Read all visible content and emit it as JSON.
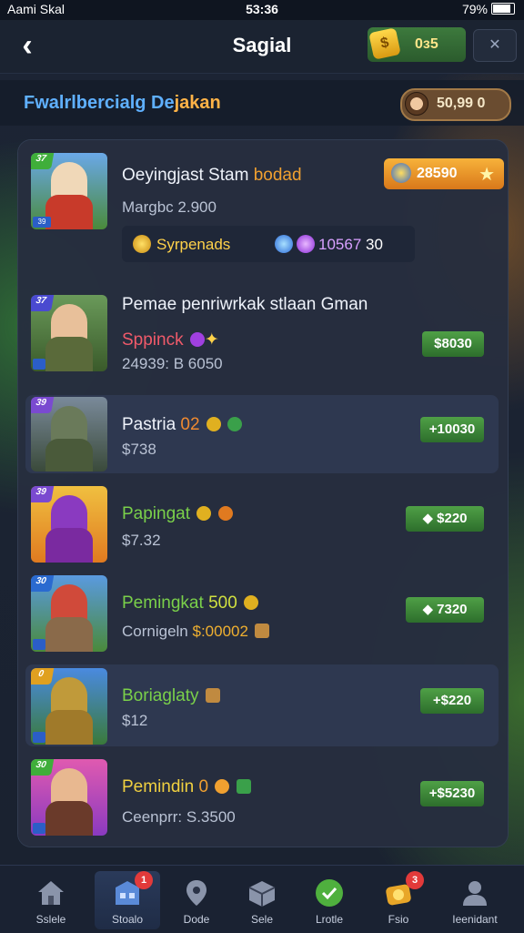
{
  "status": {
    "carrier": "Aami Skal",
    "time": "53:36",
    "battery": "79%"
  },
  "header": {
    "title": "Sagial",
    "currency": "0ɜ5",
    "close_icon": "close-icon"
  },
  "subheader": {
    "title_a": "Fwalrlbercialg De",
    "title_b": "jakan",
    "balance": "50,99 0"
  },
  "featured": {
    "level": "37",
    "thumb_tag": "39",
    "name": "Oeyingjast Stam",
    "name_tag": "bodad",
    "sub": "Margbc 2.900",
    "badge_value": "28590",
    "stat_label": "Syrpenads",
    "stat_value_a": "10567",
    "stat_value_b": "30"
  },
  "items": [
    {
      "level": "37",
      "section": "Pemae penriwrkak stlaan Gman",
      "name": "Sppinck",
      "sub": "24939: B 6050",
      "price": "$8030"
    },
    {
      "level": "39",
      "name": "Pastria",
      "name_tag": "02",
      "sub": "$738",
      "price": "+10030"
    },
    {
      "level": "39",
      "name": "Papingat",
      "sub": "$7.32",
      "price": "$220"
    },
    {
      "level": "30",
      "name": "Pemingkat",
      "name_tag": "500",
      "sub": "Cornigeln",
      "sub_tag": "$:00002",
      "price": "7320"
    },
    {
      "level": "0",
      "name": "Boriaglaty",
      "sub": "$12",
      "price": "+$220"
    },
    {
      "level": "30",
      "name": "Pemindin",
      "name_tag": "0",
      "sub": "Ceenprr: S.3500",
      "price": "+$5230"
    }
  ],
  "nav": [
    {
      "label": "Sslele",
      "icon": "house-icon"
    },
    {
      "label": "Stoalo",
      "icon": "shop-icon",
      "badge": "1"
    },
    {
      "label": "Dode",
      "icon": "map-pin-icon"
    },
    {
      "label": "Sele",
      "icon": "box-icon"
    },
    {
      "label": "Lrotle",
      "icon": "check-icon"
    },
    {
      "label": "Fsio",
      "icon": "coin-bag-icon",
      "badge": "3"
    },
    {
      "label": "Ieenidant",
      "icon": "user-icon"
    }
  ],
  "colors": {
    "accent_green": "#3f8f3b",
    "accent_orange": "#f0a030",
    "panel": "#262e3e"
  }
}
